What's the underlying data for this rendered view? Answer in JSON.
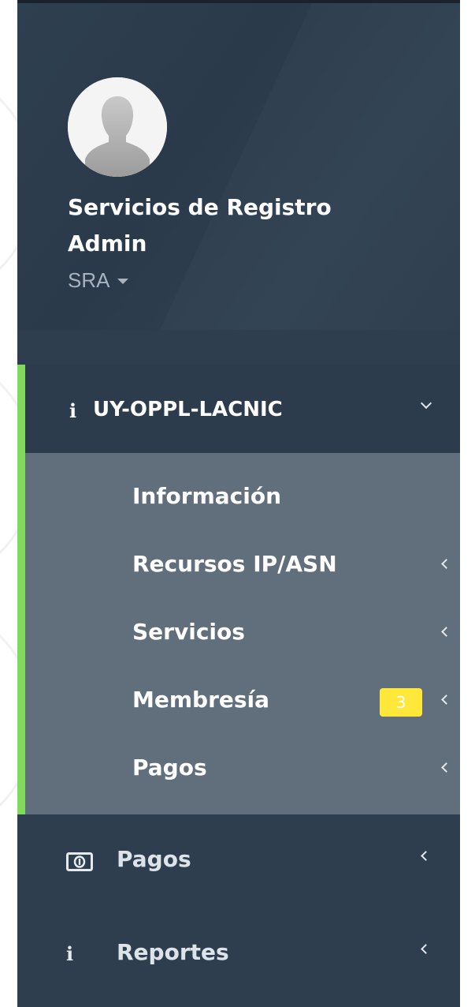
{
  "profile": {
    "name": "Servicios de Registro Admin",
    "role": "SRA"
  },
  "menu": {
    "group": {
      "title": "UY-OPPL-LACNIC",
      "items": [
        {
          "label": "Información",
          "has_chevron": false
        },
        {
          "label": "Recursos IP/ASN",
          "has_chevron": true
        },
        {
          "label": "Servicios",
          "has_chevron": true
        },
        {
          "label": "Membresía",
          "has_chevron": true,
          "badge": "3"
        },
        {
          "label": "Pagos",
          "has_chevron": true
        }
      ]
    },
    "top_items": [
      {
        "label": "Pagos",
        "icon": "money-icon"
      },
      {
        "label": "Reportes",
        "icon": "info-icon"
      }
    ]
  },
  "colors": {
    "sidebar_bg": "#2e3e4e",
    "submenu_bg": "#616f7c",
    "accent": "#7fda5e",
    "badge": "#ffe839"
  }
}
